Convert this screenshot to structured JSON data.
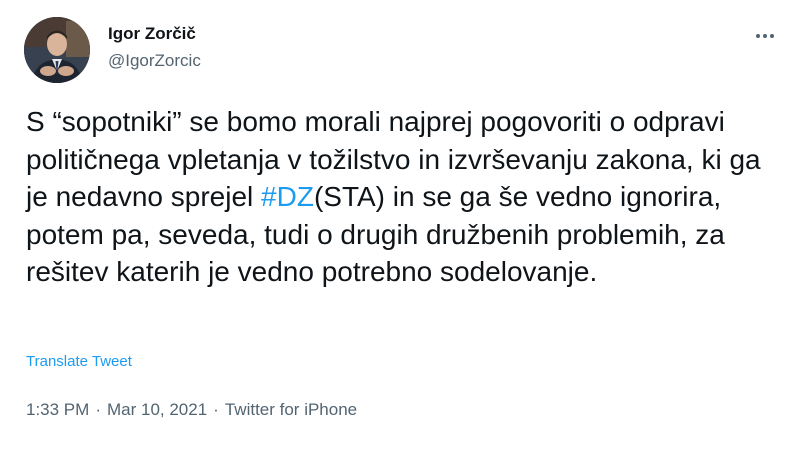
{
  "author": {
    "display_name": "Igor Zorčič",
    "handle": "@IgorZorcic"
  },
  "tweet": {
    "text_before": "S “sopotniki” se bomo morali najprej pogovoriti o odpravi političnega vpletanja v tožilstvo in izvrševanju zakona, ki ga je nedavno sprejel ",
    "hashtag": "#DZ",
    "text_after": "(STA) in se ga še vedno ignorira, potem pa, seveda,  tudi o drugih družbenih problemih, za rešitev katerih je vedno potrebno sodelovanje."
  },
  "translate_label": "Translate Tweet",
  "meta": {
    "time": "1:33 PM",
    "separator": "·",
    "date": "Mar 10, 2021",
    "source": "Twitter for iPhone"
  },
  "icons": {
    "more": "more-dots-icon",
    "avatar": "avatar-photo"
  },
  "colors": {
    "link": "#1d9bf0",
    "text": "#0f1419",
    "secondary": "#536471"
  }
}
